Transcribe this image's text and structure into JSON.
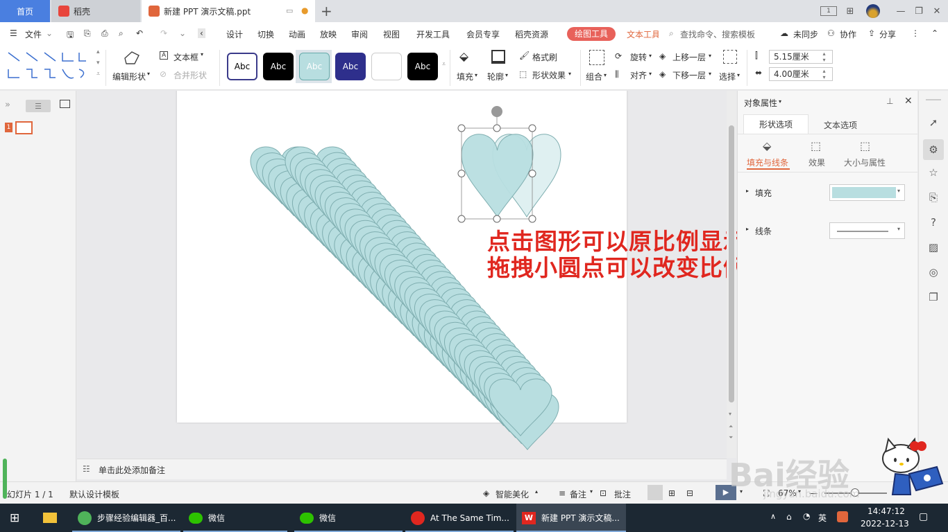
{
  "titlebar": {
    "home_tab": "首页",
    "docer_tab": "稻壳",
    "doc_tab": "新建 PPT 演示文稿.ppt",
    "page_badge": "1"
  },
  "menubar": {
    "file": "文件",
    "items": [
      "设计",
      "切换",
      "动画",
      "放映",
      "审阅",
      "视图",
      "开发工具",
      "会员专享",
      "稻壳资源"
    ],
    "draw_tools": "绘图工具",
    "text_tools": "文本工具",
    "search_placeholder": "查找命令、搜索模板",
    "sync": "未同步",
    "collab": "协作",
    "share": "分享"
  },
  "ribbon": {
    "edit_shape": "编辑形状",
    "text_box": "文本框",
    "merge_shape": "合并形状",
    "style_labels": [
      "Abc",
      "Abc",
      "Abc",
      "Abc",
      "",
      "Abc"
    ],
    "fill": "填充",
    "outline": "轮廓",
    "format_painter": "格式刷",
    "shape_effects": "形状效果",
    "group": "组合",
    "rotate": "旋转",
    "align": "对齐",
    "bring_forward": "上移一层",
    "send_backward": "下移一层",
    "select": "选择",
    "height": "5.15厘米",
    "width": "4.00厘米"
  },
  "leftpane": {
    "slide_num": "1"
  },
  "annotation": {
    "line1": "点击图形可以原比例显示",
    "line2": "拖拽小圆点可以改变比例"
  },
  "notes": {
    "placeholder": "单击此处添加备注"
  },
  "rightpanel": {
    "title": "对象属性",
    "tab_shape": "形状选项",
    "tab_text": "文本选项",
    "sub_fill_line": "填充与线条",
    "sub_effects": "效果",
    "sub_size": "大小与属性",
    "fill_label": "填充",
    "line_label": "线条",
    "fill_color": "#b8dee0"
  },
  "statusbar": {
    "slide_counter": "幻灯片 1 / 1",
    "template": "默认设计模板",
    "smart": "智能美化",
    "notes": "备注",
    "comment": "批注",
    "zoom": "67%"
  },
  "taskbar": {
    "tasks": [
      "步骤经验编辑器_百...",
      "微信",
      "微信",
      "At The Same Tim...",
      "新建 PPT 演示文稿..."
    ],
    "lang": "英",
    "time": "14:47:12",
    "date": "2022-12-13"
  },
  "watermark": {
    "text": "Bai经验",
    "url": "jingyan.baidu.com"
  },
  "colors": {
    "accent": "#4a7fe0",
    "draw_tools_bg": "#e8615a",
    "heart_fill": "#b8dee0",
    "heart_stroke": "#7faeb0",
    "annotation": "#e0271f"
  }
}
